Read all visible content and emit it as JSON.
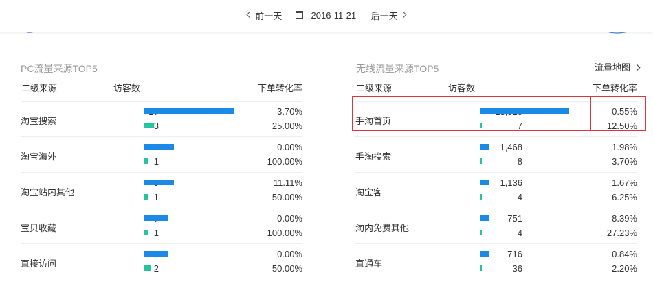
{
  "date_nav": {
    "prev_label": "前一天",
    "date": "2016-11-21",
    "next_label": "后一天"
  },
  "pc": {
    "title": "PC流量来源TOP5",
    "headers": {
      "source": "二级来源",
      "visitors": "访客数",
      "conversion": "下单转化率"
    },
    "rows": [
      {
        "name": "淘宝搜索",
        "v1": "27",
        "v2": "3",
        "r1": "3.70%",
        "r2": "25.00%"
      },
      {
        "name": "淘宝海外",
        "v1": "9",
        "v2": "1",
        "r1": "0.00%",
        "r2": "100.00%"
      },
      {
        "name": "淘宝站内其他",
        "v1": "9",
        "v2": "1",
        "r1": "11.11%",
        "r2": "50.00%"
      },
      {
        "name": "宝贝收藏",
        "v1": "7",
        "v2": "1",
        "r1": "0.00%",
        "r2": "100.00%"
      },
      {
        "name": "直接访问",
        "v1": "7",
        "v2": "2",
        "r1": "0.00%",
        "r2": "50.00%"
      }
    ],
    "bar_values": [
      [
        27,
        3
      ],
      [
        9,
        1
      ],
      [
        9,
        1
      ],
      [
        7,
        1
      ],
      [
        7,
        2
      ]
    ],
    "bar_max": 27
  },
  "mobile": {
    "title": "无线流量来源TOP5",
    "link": "流量地图",
    "headers": {
      "source": "二级来源",
      "visitors": "访客数",
      "conversion": "下单转化率"
    },
    "rows": [
      {
        "name": "手淘首页",
        "v1": "13,920",
        "v2": "7",
        "r1": "0.55%",
        "r2": "12.50%"
      },
      {
        "name": "手淘搜索",
        "v1": "1,468",
        "v2": "8",
        "r1": "1.98%",
        "r2": "3.70%"
      },
      {
        "name": "淘宝客",
        "v1": "1,136",
        "v2": "4",
        "r1": "1.67%",
        "r2": "6.25%"
      },
      {
        "name": "淘内免费其他",
        "v1": "751",
        "v2": "4",
        "r1": "8.39%",
        "r2": "27.23%"
      },
      {
        "name": "直通车",
        "v1": "716",
        "v2": "36",
        "r1": "0.84%",
        "r2": "2.20%"
      }
    ],
    "bar_values": [
      [
        13920,
        7
      ],
      [
        1468,
        8
      ],
      [
        1136,
        4
      ],
      [
        751,
        4
      ],
      [
        716,
        36
      ]
    ],
    "bar_max": 13920
  },
  "colors": {
    "visitor_bar": "#1a8ae6",
    "order_bar": "#23c4a0",
    "highlight": "#d9363e"
  },
  "icons": [
    "chevron-left-icon",
    "calendar-icon",
    "chevron-right-icon"
  ]
}
